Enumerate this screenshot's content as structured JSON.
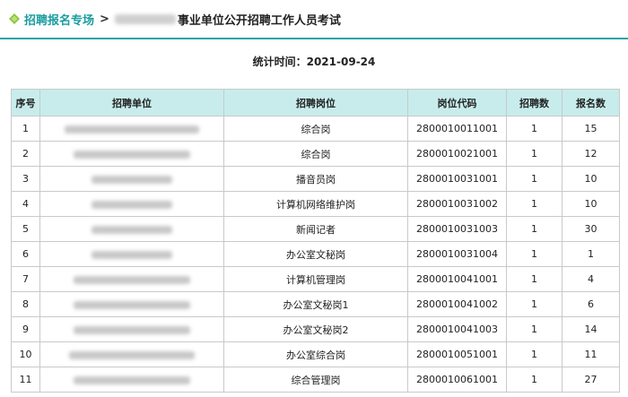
{
  "breadcrumb": {
    "icon": "diamond-icon",
    "home_label": "招聘报名专场",
    "separator": ">",
    "title_suffix": "事业单位公开招聘工作人员考试"
  },
  "stat": {
    "label": "统计时间：2021-09-24"
  },
  "table": {
    "headers": [
      "序号",
      "招聘单位",
      "招聘岗位",
      "岗位代码",
      "招聘数",
      "报名数"
    ],
    "rows": [
      {
        "seq": "1",
        "post": "综合岗",
        "code": "2800010011001",
        "quota": "1",
        "applicants": "15"
      },
      {
        "seq": "2",
        "post": "综合岗",
        "code": "2800010021001",
        "quota": "1",
        "applicants": "12"
      },
      {
        "seq": "3",
        "post": "播音员岗",
        "code": "2800010031001",
        "quota": "1",
        "applicants": "10"
      },
      {
        "seq": "4",
        "post": "计算机网络维护岗",
        "code": "2800010031002",
        "quota": "1",
        "applicants": "10"
      },
      {
        "seq": "5",
        "post": "新闻记者",
        "code": "2800010031003",
        "quota": "1",
        "applicants": "30"
      },
      {
        "seq": "6",
        "post": "办公室文秘岗",
        "code": "2800010031004",
        "quota": "1",
        "applicants": "1"
      },
      {
        "seq": "7",
        "post": "计算机管理岗",
        "code": "2800010041001",
        "quota": "1",
        "applicants": "4"
      },
      {
        "seq": "8",
        "post": "办公室文秘岗1",
        "code": "2800010041002",
        "quota": "1",
        "applicants": "6"
      },
      {
        "seq": "9",
        "post": "办公室文秘岗2",
        "code": "2800010041003",
        "quota": "1",
        "applicants": "14"
      },
      {
        "seq": "10",
        "post": "办公室综合岗",
        "code": "2800010051001",
        "quota": "1",
        "applicants": "11"
      },
      {
        "seq": "11",
        "post": "综合管理岗",
        "code": "2800010061001",
        "quota": "1",
        "applicants": "27"
      }
    ]
  },
  "colors": {
    "accent": "#2aa3a6",
    "link": "#1a9c9f",
    "header_bg": "#c8ecec",
    "icon": "#8cc63f"
  }
}
